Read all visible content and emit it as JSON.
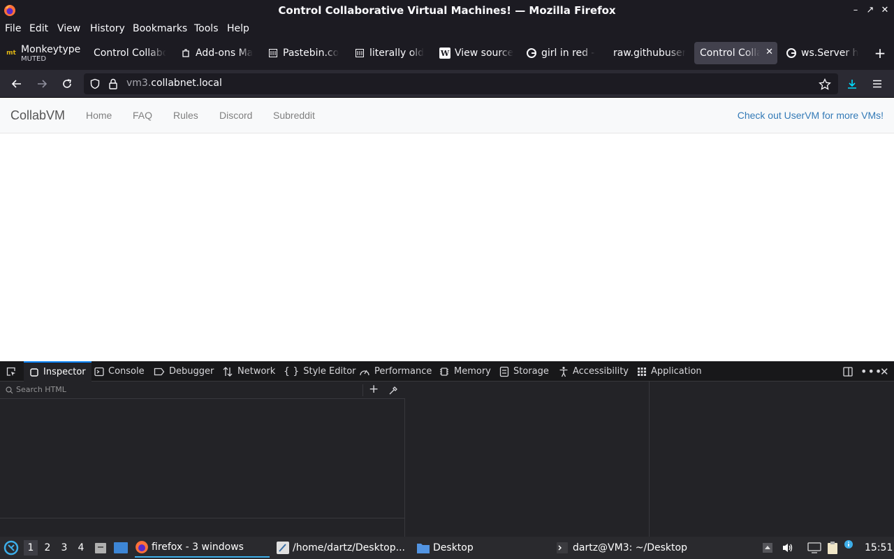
{
  "window": {
    "title": "Control Collaborative Virtual Machines! — Mozilla Firefox"
  },
  "menubar": {
    "items": [
      "File",
      "Edit",
      "View",
      "History",
      "Bookmarks",
      "Tools",
      "Help"
    ]
  },
  "tabs": [
    {
      "label": "Monkeytype",
      "sub": "MUTED",
      "icon": "monkeytype-icon"
    },
    {
      "label": "Control Collabo",
      "icon": "none"
    },
    {
      "label": "Add-ons Ma",
      "icon": "puzzle-icon"
    },
    {
      "label": "Pastebin.co",
      "icon": "pastebin-icon"
    },
    {
      "label": "literally old",
      "icon": "pastebin-icon"
    },
    {
      "label": "View source",
      "icon": "wikipedia-icon"
    },
    {
      "label": "girl in red - ",
      "icon": "google-icon"
    },
    {
      "label": "raw.githubuser",
      "icon": "none"
    },
    {
      "label": "Control Colla",
      "icon": "none",
      "active": true
    },
    {
      "label": "ws.Server h",
      "icon": "google-icon"
    }
  ],
  "navbar": {
    "url_prefix": "vm3.",
    "url_domain": "collabnet.local"
  },
  "site": {
    "brand": "CollabVM",
    "links": [
      "Home",
      "FAQ",
      "Rules",
      "Discord",
      "Subreddit"
    ],
    "promo": "Check out UserVM for more VMs!"
  },
  "devtools": {
    "tabs": [
      "Inspector",
      "Console",
      "Debugger",
      "Network",
      "Style Editor",
      "Performance",
      "Memory",
      "Storage",
      "Accessibility",
      "Application"
    ],
    "active_tab": "Inspector",
    "search_placeholder": "Search HTML"
  },
  "taskbar": {
    "workspaces": [
      "1",
      "2",
      "3",
      "4"
    ],
    "tasks": [
      {
        "label": "firefox - 3 windows",
        "active": true
      },
      {
        "label": "/home/dartz/Desktop...",
        "active": false
      },
      {
        "label": "Desktop",
        "active": false
      },
      {
        "label": "dartz@VM3: ~/Desktop",
        "active": false
      }
    ],
    "clock": "15:51"
  },
  "colors": {
    "accent": "#0a84ff",
    "link": "#337ab7",
    "chrome_dark": "#1c1b22"
  }
}
